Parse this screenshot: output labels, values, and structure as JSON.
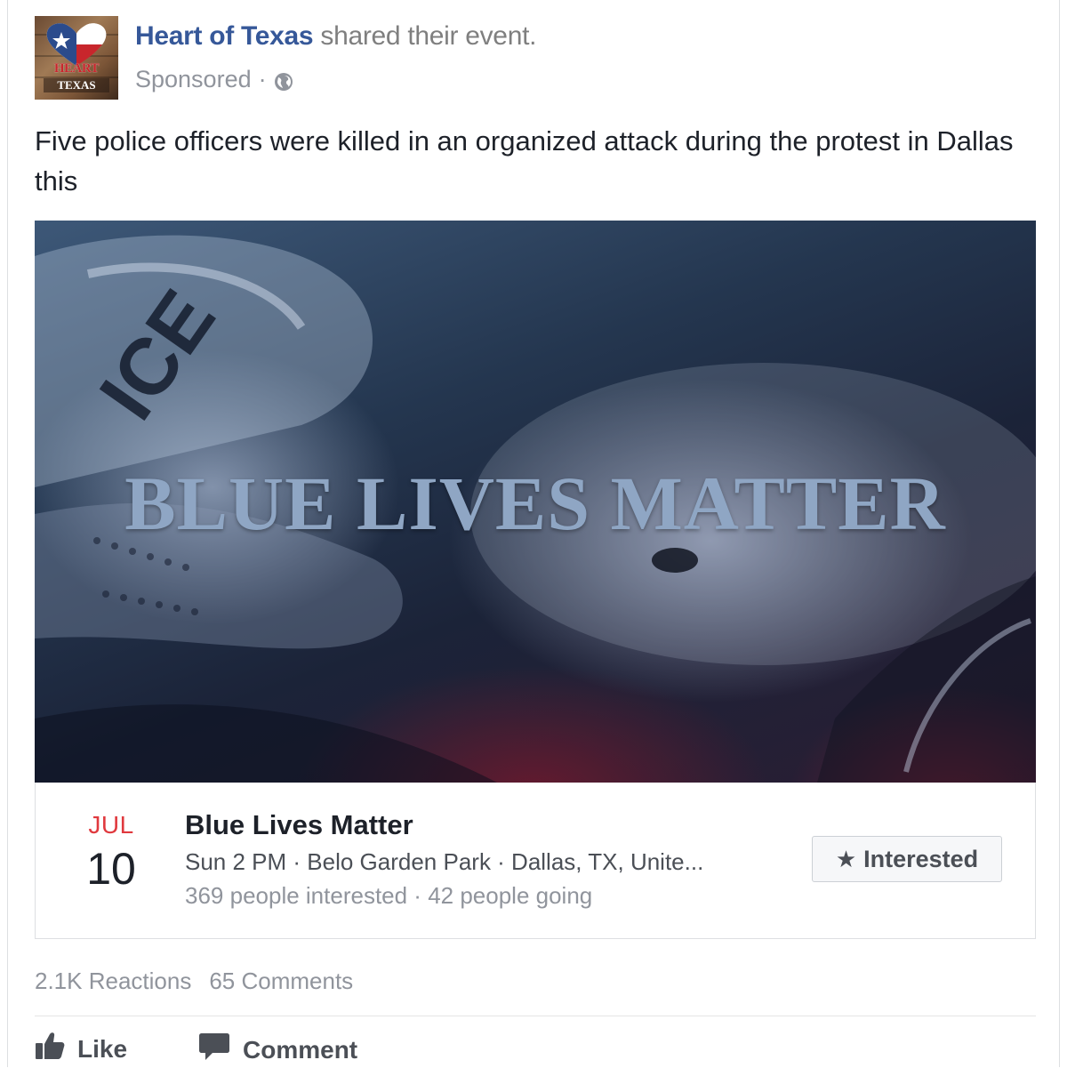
{
  "post": {
    "page_name": "Heart of Texas",
    "shared_text": " shared their event.",
    "sponsored_label": "Sponsored",
    "separator": "·",
    "privacy_icon": "globe-icon",
    "avatar_logo": {
      "line1": "HEART",
      "line2": "TEXAS",
      "icon": "texas-heart-flag-logo"
    },
    "body_text": "Five police officers were killed in an organized attack during the protest in Dallas this"
  },
  "event": {
    "cover_title": "BLUE LIVES MATTER",
    "month": "JUL",
    "day": "10",
    "title": "Blue Lives Matter",
    "details": "Sun 2 PM · Belo Garden Park · Dallas, TX, Unite...",
    "stats": "369 people interested · 42 people going",
    "interested_button": "Interested",
    "interested_icon": "star-icon"
  },
  "engagement": {
    "reactions": "2.1K Reactions",
    "comments": "65 Comments"
  },
  "actions": {
    "like_label": "Like",
    "like_icon": "thumbs-up-icon",
    "comment_label": "Comment",
    "comment_icon": "comment-bubble-icon"
  },
  "colors": {
    "link_blue": "#365899",
    "month_red": "#e0393e",
    "muted_gray": "#90949c",
    "cover_text": "#8fa6c4"
  }
}
